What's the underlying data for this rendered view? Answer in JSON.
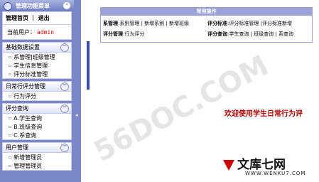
{
  "sidebar": {
    "title": "管理功能菜单",
    "links": "管理首页 ｜ 退出",
    "user_label": "当前用户：",
    "user_name": "admin",
    "groups": [
      {
        "title": "基础数据设置",
        "items": [
          "系管理|班级管理",
          "学生信息管理",
          "评分标准管理"
        ]
      },
      {
        "title": "日常行评分管理",
        "items": [
          "行为评分"
        ]
      },
      {
        "title": "评分查询",
        "items": [
          "A.学生查询",
          "B.班级查询",
          "C.系查询"
        ]
      },
      {
        "title": "用户管理",
        "items": [
          "新增管理员",
          "管理管理员"
        ]
      }
    ]
  },
  "main": {
    "card_title": "常用操作",
    "row1_left_label": "系管理",
    "row1_left_links": ":系别管理 | 新增系别 | 新增班级",
    "row1_right_label": "评分标准",
    "row1_right_links": ":评分标准管理 |评分标准新增",
    "row2_left_label": "评分管理",
    "row2_left_links": ":行为评分",
    "row2_right_label": "评分查询",
    "row2_right_links": ":学生查询 | 班级查询 | 系查询",
    "welcome": "欢迎使用学生日常行为评"
  },
  "watermarks": {
    "diagonal": "56DOC.COM",
    "brand_text": "文库七网",
    "brand_url": "WWW.WENKU7.COM"
  }
}
